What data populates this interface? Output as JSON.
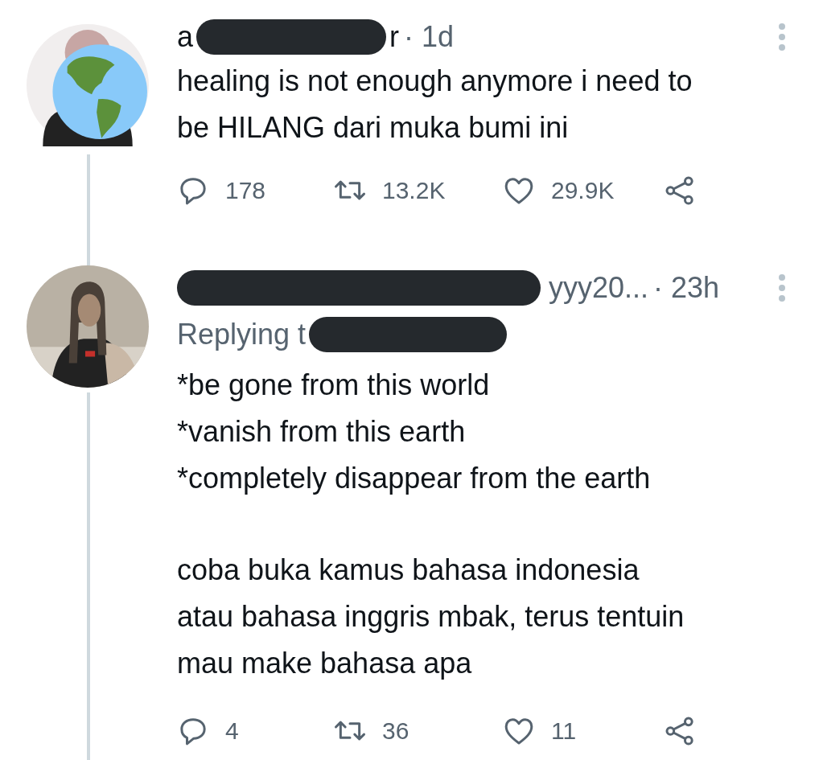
{
  "tweets": [
    {
      "avatar": {
        "kind": "globe"
      },
      "header": [
        {
          "kind": "name",
          "text": "a"
        },
        {
          "kind": "redaction"
        },
        {
          "kind": "name",
          "text": "r"
        },
        {
          "kind": "meta",
          "text": "· 1d"
        }
      ],
      "body": [
        "healing is not enough anymore i need to\nbe HILANG dari muka bumi ini"
      ],
      "actions": {
        "replies": "178",
        "retweets": "13.2K",
        "likes": "29.9K"
      }
    },
    {
      "avatar": {
        "kind": "picture"
      },
      "header": [
        {
          "kind": "redaction"
        },
        {
          "kind": "meta",
          "text": "yyy20..."
        },
        {
          "kind": "meta",
          "text": "· 23h"
        }
      ],
      "replying": [
        {
          "kind": "meta",
          "text": "Replying t"
        },
        {
          "kind": "redaction"
        }
      ],
      "body": [
        "*be gone from this world\n*vanish from this earth\n*completely disappear from the earth",
        "coba buka kamus bahasa indonesia\natau bahasa inggris mbak, terus tentuin\nmau make bahasa apa"
      ],
      "actions": {
        "replies": "4",
        "retweets": "36",
        "likes": "11"
      }
    }
  ]
}
